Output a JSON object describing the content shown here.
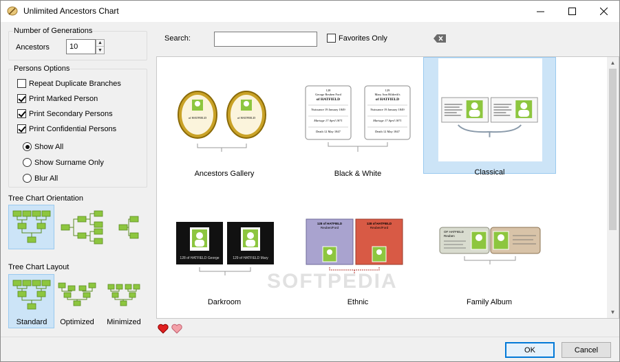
{
  "window": {
    "title": "Unlimited Ancestors Chart"
  },
  "generations": {
    "group_label": "Number of Generations",
    "ancestors_label": "Ancestors",
    "ancestors_value": "10"
  },
  "persons": {
    "group_label": "Persons Options",
    "options": [
      {
        "label": "Repeat Duplicate Branches",
        "checked": false
      },
      {
        "label": "Print Marked Person",
        "checked": true
      },
      {
        "label": "Print Secondary Persons",
        "checked": true
      },
      {
        "label": "Print Confidential Persons",
        "checked": true
      }
    ],
    "display": [
      {
        "label": "Show All",
        "selected": true
      },
      {
        "label": "Show Surname Only",
        "selected": false
      },
      {
        "label": "Blur All",
        "selected": false
      }
    ]
  },
  "orientation": {
    "label": "Tree Chart Orientation"
  },
  "layout": {
    "label": "Tree Chart Layout",
    "options": [
      "Standard",
      "Optimized",
      "Minimized"
    ],
    "selected": "Standard"
  },
  "search": {
    "label": "Search:",
    "value": "",
    "favorites_label": "Favorites Only",
    "favorites_checked": false
  },
  "gallery": {
    "selected": "Classical",
    "items": [
      {
        "name": "Ancestors Gallery"
      },
      {
        "name": "Black & White"
      },
      {
        "name": "Classical"
      },
      {
        "name": "Darkroom"
      },
      {
        "name": "Ethnic"
      },
      {
        "name": "Family Album"
      }
    ]
  },
  "cards": {
    "family": "of HATFIELD",
    "bw_num_left": "128",
    "bw_num_right": "129",
    "bw_name_left": "George Reuben Ford",
    "bw_name_right": "Mary Ann Hildreth's",
    "bw_born_left": "Nuissance 19 January 1849",
    "bw_born_right": "Nuissance 19 January 1849",
    "bw_marr": "Mariage 17 April 1871",
    "bw_death": "Death 12 May 1847",
    "dark_left": "128 of HATFIELD George",
    "dark_right": "129 of HATFIELD Mary",
    "ethnic_top": "128 of HATFIELD",
    "ethnic_name": "Reuben/Ford",
    "album_family": "OF HATFIELD",
    "album_name": "Reuben"
  },
  "buttons": {
    "ok": "OK",
    "cancel": "Cancel"
  },
  "watermark": "SOFTPEDIA",
  "colors": {
    "accent": "#0078d7",
    "selection": "#cce4f7",
    "plant": "#8dc63f"
  }
}
